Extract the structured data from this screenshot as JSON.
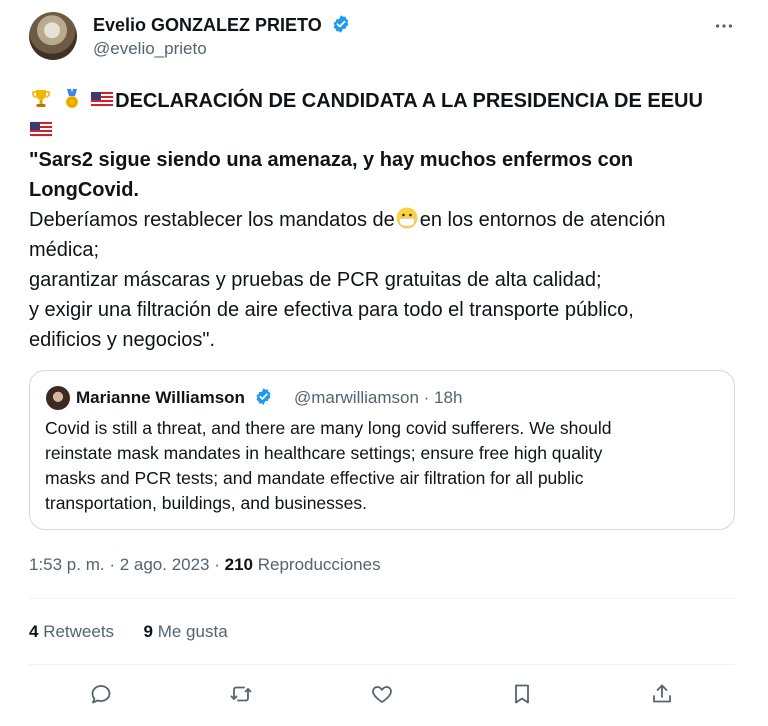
{
  "author": {
    "name": "Evelio GONZALEZ PRIETO",
    "handle": "@evelio_prieto"
  },
  "tweet": {
    "headline": "DECLARACIÓN DE CANDIDATA A LA PRESIDENCIA DE EEUU",
    "quote_line1": "\"Sars2 sigue siendo una amenaza, y hay muchos enfermos con",
    "quote_line2": "LongCovid.",
    "line3a": "Deberíamos restablecer los mandatos de",
    "line3b": "en los entornos de atención",
    "line4": "médica;",
    "line5": "garantizar máscaras y pruebas de PCR gratuitas de alta calidad;",
    "line6": "y exigir una filtración de aire efectiva para todo el transporte público,",
    "line7": "edificios y negocios\"."
  },
  "quoted_tweet": {
    "name": "Marianne Williamson",
    "handle_time": "@marwilliamson · 18h",
    "lines": [
      "Covid is still a threat, and there are many long covid sufferers. We should",
      "reinstate mask mandates in healthcare settings; ensure free high quality",
      "masks and PCR tests; and mandate effective air filtration for all public",
      "transportation, buildings, and businesses."
    ]
  },
  "meta": {
    "time_date": "1:53 p. m. · 2 ago. 2023 · ",
    "views_count": "210",
    "views_label": " Reproducciones"
  },
  "stats": {
    "retweets_count": "4",
    "retweets_label": " Retweets",
    "likes_count": "9",
    "likes_label": " Me gusta"
  },
  "icons": {
    "verified": "verified-badge-icon",
    "more": "more-icon",
    "reply": "reply-icon",
    "retweet": "retweet-icon",
    "like": "heart-icon",
    "bookmark": "bookmark-icon",
    "share": "share-icon"
  },
  "colors": {
    "verified": "#1d9bf0",
    "text": "#0f1419",
    "secondary": "#536471",
    "border": "#cfd9de"
  }
}
